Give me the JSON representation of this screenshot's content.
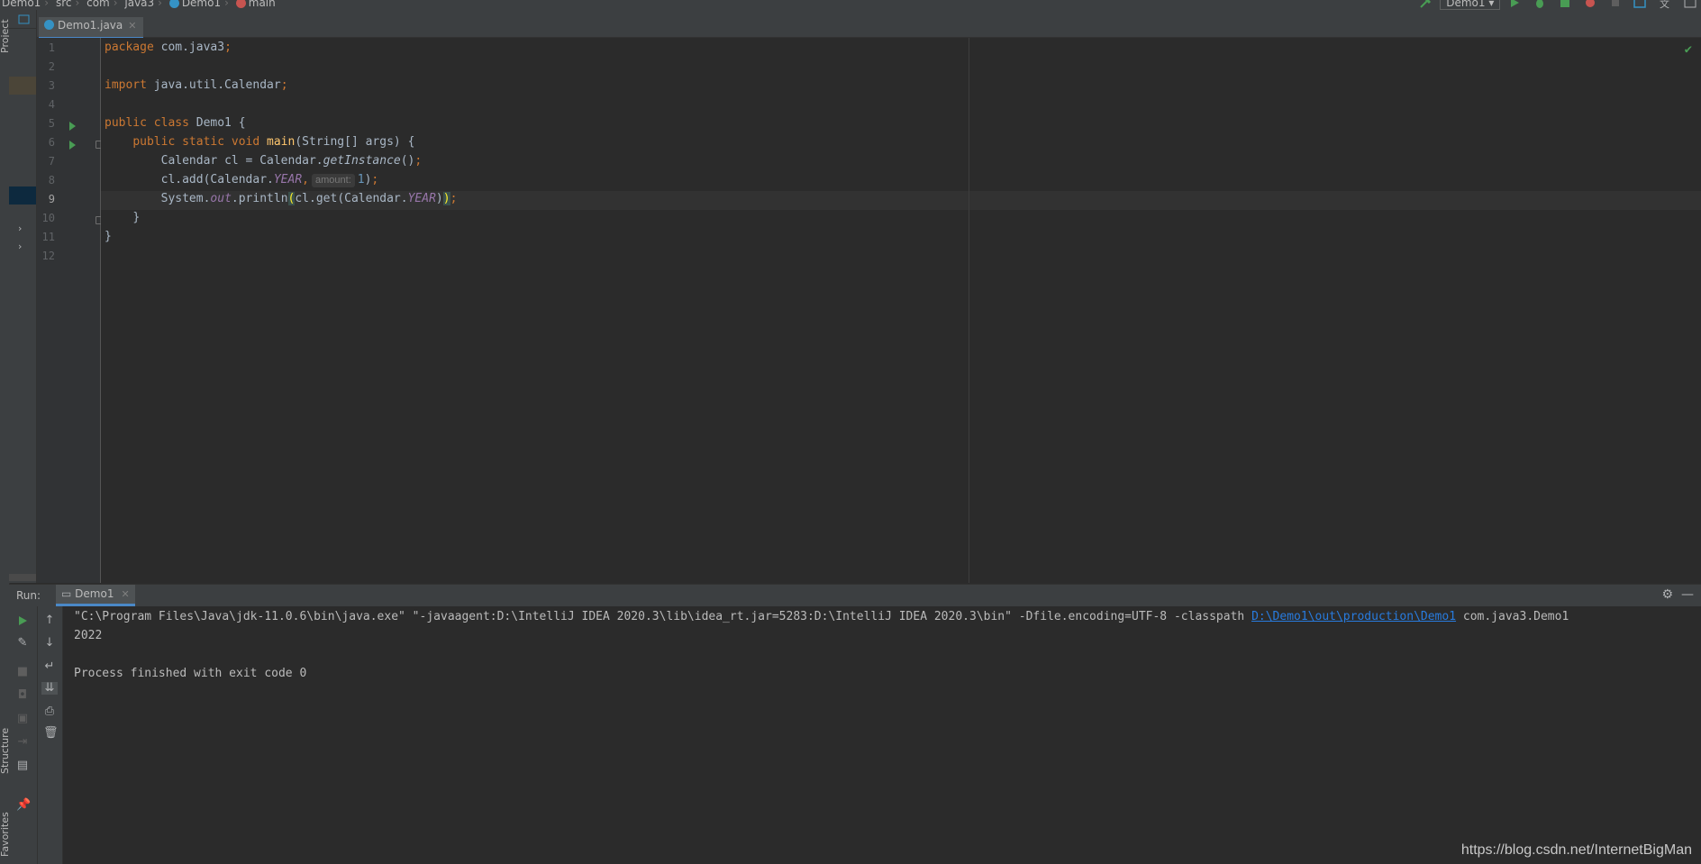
{
  "breadcrumb": [
    "Demo1",
    "src",
    "com",
    "java3",
    "Demo1",
    "main"
  ],
  "toolbar": {
    "run_config": "Demo1"
  },
  "left_strip": {
    "project_label": "Project",
    "structure_label": "Structure",
    "favorites_label": "Favorites"
  },
  "editor": {
    "tab_label": "Demo1.java",
    "line_numbers": [
      "1",
      "2",
      "3",
      "4",
      "5",
      "6",
      "7",
      "8",
      "9",
      "10",
      "11",
      "12"
    ],
    "lines": {
      "l1_kw": "package",
      "l1_rest": " com.java3",
      "l1_semi": ";",
      "l3_kw": "import",
      "l3_rest": " java.util.Calendar",
      "l3_semi": ";",
      "l5_kw": "public class",
      "l5_rest": " Demo1 {",
      "l6_kw": "public static void",
      "l6_fn": "main",
      "l6_rest": "(String[] args) {",
      "l7_a": "Calendar cl = Calendar.",
      "l7_it": "getInstance",
      "l7_b": "()",
      "l7_semi": ";",
      "l8_a": "cl.add(Calendar.",
      "l8_st": "YEAR",
      "l8_comma": ",",
      "l8_hint": "amount:",
      "l8_num": "1",
      "l8_b": ")",
      "l8_semi": ";",
      "l9_a": "System.",
      "l9_st": "out",
      "l9_b": ".println",
      "l9_p": "(",
      "l9_c": "cl.get(Calendar.",
      "l9_st2": "YEAR",
      "l9_d": ")",
      "l9_p2": ")",
      "l9_semi": ";",
      "l10": "}",
      "l11": "}"
    }
  },
  "run_panel": {
    "label": "Run:",
    "tab_label": "Demo1",
    "console": {
      "cmd_prefix": "\"C:\\Program Files\\Java\\jdk-11.0.6\\bin\\java.exe\" \"-javaagent:D:\\IntelliJ IDEA 2020.3\\lib\\idea_rt.jar=5283:D:\\IntelliJ IDEA 2020.3\\bin\" -Dfile.encoding=UTF-8 -classpath ",
      "cmd_link": "D:\\Demo1\\out\\production\\Demo1",
      "cmd_suffix": " com.java3.Demo1",
      "output": "2022",
      "finished": "Process finished with exit code 0"
    }
  },
  "watermark": "https://blog.csdn.net/InternetBigMan",
  "colors": {
    "background": "#2b2b2b",
    "keyword": "#cc7832",
    "function": "#ffc66d",
    "static_field": "#9876aa",
    "number": "#6897bb",
    "link": "#287bde",
    "run_green": "#499c54"
  }
}
